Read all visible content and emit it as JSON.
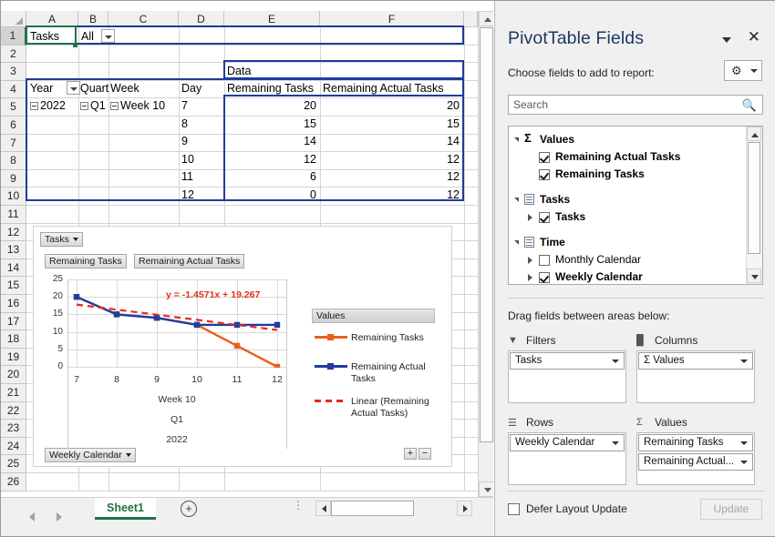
{
  "grid": {
    "columns": [
      "A",
      "B",
      "C",
      "D",
      "E",
      "F"
    ],
    "rows": [
      "1",
      "2",
      "3",
      "4",
      "5",
      "6",
      "7",
      "8",
      "9",
      "10",
      "11",
      "12",
      "13",
      "14",
      "15",
      "16",
      "17",
      "18",
      "19",
      "20",
      "21",
      "22",
      "23",
      "24",
      "25",
      "26"
    ],
    "selected_cell": "A1",
    "cells": {
      "a1": "Tasks",
      "b1": "All",
      "e3": "Data",
      "a4": "Year",
      "b4": "Quart",
      "c4": "Week",
      "d4": "Day",
      "e4": "Remaining Tasks",
      "f4": "Remaining Actual Tasks",
      "a5": "2022",
      "b5": "Q1",
      "c5": "Week 10"
    },
    "data_rows": [
      {
        "day": "7",
        "remaining_tasks": "20",
        "remaining_actual_tasks": "20"
      },
      {
        "day": "8",
        "remaining_tasks": "15",
        "remaining_actual_tasks": "15"
      },
      {
        "day": "9",
        "remaining_tasks": "14",
        "remaining_actual_tasks": "14"
      },
      {
        "day": "10",
        "remaining_tasks": "12",
        "remaining_actual_tasks": "12"
      },
      {
        "day": "11",
        "remaining_tasks": "6",
        "remaining_actual_tasks": "12"
      },
      {
        "day": "12",
        "remaining_tasks": "0",
        "remaining_actual_tasks": "12"
      }
    ]
  },
  "chart_data": {
    "type": "line",
    "title": "",
    "xlabel_lines": [
      "Week 10",
      "Q1",
      "2022"
    ],
    "ylabel": "",
    "categories": [
      "7",
      "8",
      "9",
      "10",
      "11",
      "12"
    ],
    "yticks": [
      "0",
      "5",
      "10",
      "15",
      "20",
      "25"
    ],
    "ylim": [
      0,
      25
    ],
    "grid": true,
    "legend_position": "right",
    "legend_title": "Values",
    "annotation": "y = -1.4571x + 19.267",
    "trendline": {
      "slope": -1.4571,
      "intercept": 19.267,
      "label": "Linear (Remaining Actual Tasks)",
      "style": "dashed",
      "color": "#e8281e"
    },
    "series": [
      {
        "name": "Remaining Tasks",
        "values": [
          20,
          15,
          14,
          12,
          6,
          0
        ],
        "color": "#e8601c"
      },
      {
        "name": "Remaining Actual Tasks",
        "values": [
          20,
          15,
          14,
          12,
          12,
          12
        ],
        "color": "#1f3d9e"
      }
    ],
    "field_buttons": {
      "filter": "Tasks",
      "series": [
        "Remaining Tasks",
        "Remaining Actual Tasks"
      ],
      "axis": "Weekly Calendar"
    },
    "expand_label": "+",
    "collapse_label": "−"
  },
  "sheet_tabs": {
    "active": "Sheet1",
    "add_label": "+"
  },
  "panel": {
    "title": "PivotTable Fields",
    "close_label": "✕",
    "choose_label": "Choose fields to add to report:",
    "gear_label": "⚙",
    "search_placeholder": "Search",
    "search_value": "",
    "field_groups": [
      {
        "name": "Values",
        "icon": "sigma",
        "fields": [
          {
            "label": "Remaining Actual Tasks",
            "checked": true,
            "expandable": false,
            "bold": true
          },
          {
            "label": "Remaining Tasks",
            "checked": true,
            "expandable": false,
            "bold": true
          }
        ]
      },
      {
        "name": "Tasks",
        "icon": "table",
        "fields": [
          {
            "label": "Tasks",
            "checked": true,
            "expandable": true,
            "bold": true
          }
        ]
      },
      {
        "name": "Time",
        "icon": "table",
        "fields": [
          {
            "label": "Monthly Calendar",
            "checked": false,
            "expandable": true,
            "bold": false
          },
          {
            "label": "Weekly Calendar",
            "checked": true,
            "expandable": true,
            "bold": true
          }
        ]
      }
    ],
    "drag_label": "Drag fields between areas below:",
    "areas": [
      {
        "id": "filters",
        "label": "Filters",
        "items": [
          "Tasks"
        ]
      },
      {
        "id": "columns",
        "label": "Columns",
        "items": [
          "Σ Values"
        ]
      },
      {
        "id": "rows",
        "label": "Rows",
        "items": [
          "Weekly Calendar"
        ]
      },
      {
        "id": "values",
        "label": "Values",
        "items": [
          "Remaining Tasks",
          "Remaining Actual..."
        ]
      }
    ],
    "defer_label": "Defer Layout Update",
    "defer_checked": false,
    "update_label": "Update"
  },
  "colors": {
    "accent_green": "#217346",
    "pivot_outline": "#1f3b9b",
    "orange": "#e8601c",
    "blue": "#1f3d9e",
    "red": "#e8281e",
    "title_blue": "#1f3864"
  }
}
